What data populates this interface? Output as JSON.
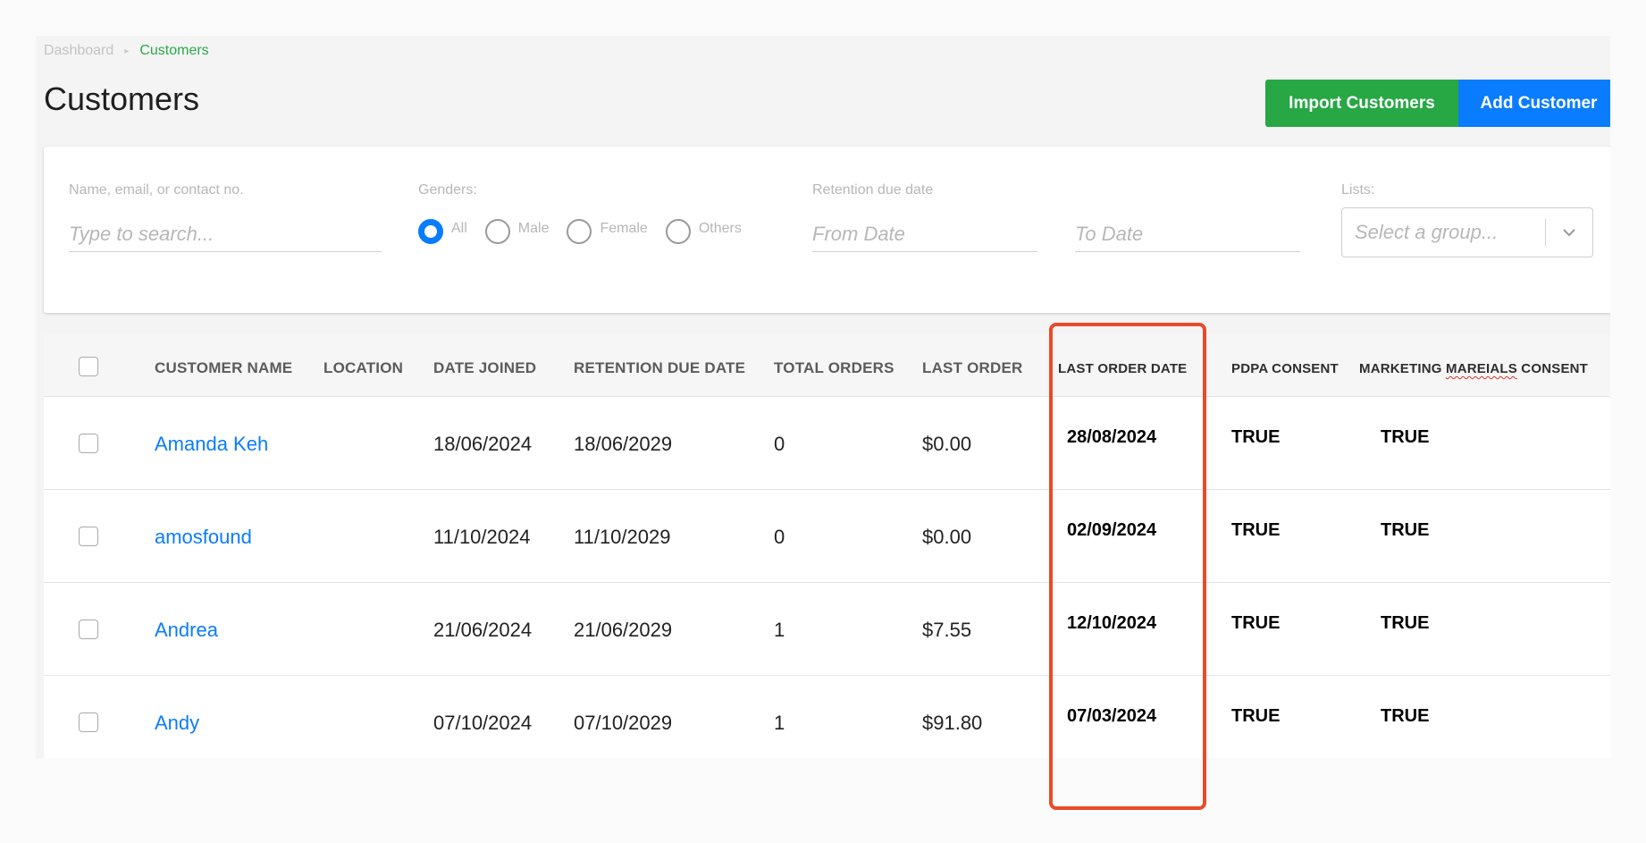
{
  "breadcrumb": {
    "parent": "Dashboard",
    "separator": "▸",
    "current": "Customers"
  },
  "page": {
    "title": "Customers"
  },
  "actions": {
    "import_label": "Import Customers",
    "add_label": "Add Customer"
  },
  "filters": {
    "search_label": "Name, email, or contact no.",
    "search_placeholder": "Type to search...",
    "genders_label": "Genders:",
    "gender_options": [
      "All",
      "Male",
      "Female",
      "Others"
    ],
    "gender_selected": "All",
    "retention_label": "Retention due date",
    "from_placeholder": "From Date",
    "to_placeholder": "To Date",
    "lists_label": "Lists:",
    "lists_placeholder": "Select a group..."
  },
  "table": {
    "columns": {
      "name": "CUSTOMER NAME",
      "location": "LOCATION",
      "joined": "DATE JOINED",
      "retention": "RETENTION DUE DATE",
      "orders": "TOTAL ORDERS",
      "last_order": "LAST ORDER",
      "last_order_date": "LAST ORDER DATE",
      "pdpa": "PDPA CONSENT",
      "marketing_prefix": "MARKETING ",
      "marketing_misspelled": "MAREIALS",
      "marketing_suffix": " CONSENT"
    },
    "rows": [
      {
        "name": "Amanda Keh",
        "location": "",
        "joined": "18/06/2024",
        "retention": "18/06/2029",
        "orders": "0",
        "last_order": "$0.00",
        "last_order_date": "28/08/2024",
        "pdpa": "TRUE",
        "marketing": "TRUE"
      },
      {
        "name": "amosfound",
        "location": "",
        "joined": "11/10/2024",
        "retention": "11/10/2029",
        "orders": "0",
        "last_order": "$0.00",
        "last_order_date": "02/09/2024",
        "pdpa": "TRUE",
        "marketing": "TRUE"
      },
      {
        "name": "Andrea",
        "location": "",
        "joined": "21/06/2024",
        "retention": "21/06/2029",
        "orders": "1",
        "last_order": "$7.55",
        "last_order_date": "12/10/2024",
        "pdpa": "TRUE",
        "marketing": "TRUE"
      },
      {
        "name": "Andy",
        "location": "",
        "joined": "07/10/2024",
        "retention": "07/10/2029",
        "orders": "1",
        "last_order": "$91.80",
        "last_order_date": "07/03/2024",
        "pdpa": "TRUE",
        "marketing": "TRUE"
      }
    ]
  },
  "colors": {
    "primary": "#0a7cff",
    "success": "#28a745",
    "highlight": "#ea4a2a"
  }
}
